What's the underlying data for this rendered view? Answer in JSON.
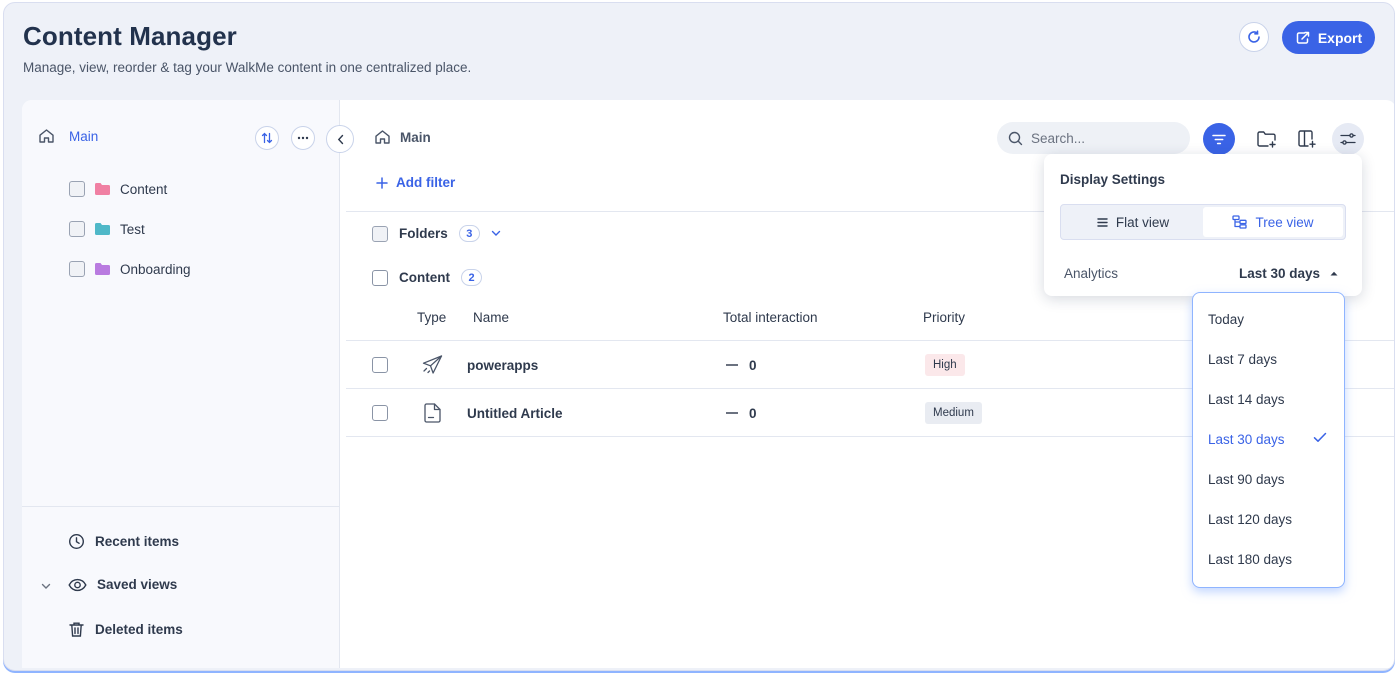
{
  "header": {
    "title": "Content Manager",
    "subtitle": "Manage, view, reorder & tag your WalkMe content in one centralized place.",
    "export_label": "Export"
  },
  "colors": {
    "accent": "#3a63e6",
    "folder_content": "#f080a3",
    "folder_test": "#4fb8c8",
    "folder_onboarding": "#b97be0"
  },
  "sidebar": {
    "root_label": "Main",
    "folders": [
      {
        "label": "Content",
        "color": "#f080a3"
      },
      {
        "label": "Test",
        "color": "#4fb8c8"
      },
      {
        "label": "Onboarding",
        "color": "#b97be0"
      }
    ],
    "bottom_links": {
      "recent": "Recent items",
      "saved": "Saved views",
      "deleted": "Deleted items"
    }
  },
  "main": {
    "breadcrumb": "Main",
    "search_placeholder": "Search...",
    "add_filter_label": "Add filter",
    "groups": {
      "folders_label": "Folders",
      "folders_count": "3",
      "content_label": "Content",
      "content_count": "2"
    },
    "columns": {
      "type": "Type",
      "name": "Name",
      "total_interaction": "Total interaction",
      "priority": "Priority"
    },
    "rows": [
      {
        "type_icon": "send-icon",
        "name": "powerapps",
        "total_interaction": "0",
        "priority": "High"
      },
      {
        "type_icon": "article-icon",
        "name": "Untitled Article",
        "total_interaction": "0",
        "priority": "Medium"
      }
    ]
  },
  "display_settings": {
    "title": "Display Settings",
    "flat_view_label": "Flat view",
    "tree_view_label": "Tree view",
    "selected_view": "Tree view",
    "analytics_label": "Analytics",
    "analytics_range": "Last 30 days"
  },
  "range_dropdown": {
    "options": [
      "Today",
      "Last 7 days",
      "Last 14 days",
      "Last 30 days",
      "Last 90 days",
      "Last 120 days",
      "Last 180 days"
    ],
    "selected": "Last 30 days"
  }
}
